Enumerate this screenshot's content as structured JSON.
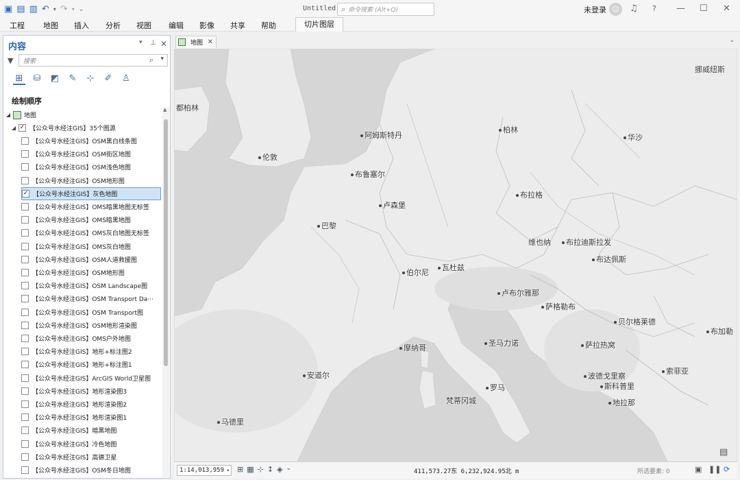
{
  "titlebar": {
    "title": "Untitled",
    "command_search_placeholder": "命令搜索 (Alt+Q)",
    "user": "未登录",
    "help": "?",
    "minimize": "—",
    "maximize": "☐",
    "close": "✕"
  },
  "menu": {
    "items": [
      "工程",
      "地图",
      "插入",
      "分析",
      "视图",
      "编辑",
      "影像",
      "共享",
      "帮助"
    ],
    "context_tab": "切片图层"
  },
  "contents": {
    "title": "内容",
    "search_placeholder": "搜索",
    "drawing_order": "绘制顺序",
    "map_node": "地图",
    "group_node": "【公众号水经注GIS】35个图源",
    "layers": [
      {
        "label": "【公众号水经注GIS】OSM黑白线条图",
        "checked": false
      },
      {
        "label": "【公众号水经注GIS】OSM街区地图",
        "checked": false
      },
      {
        "label": "【公众号水经注GIS】OSM浅色地图",
        "checked": false
      },
      {
        "label": "【公众号水经注GIS】OSM地形图",
        "checked": false
      },
      {
        "label": "【公众号水经注GIS】灰色地图",
        "checked": true
      },
      {
        "label": "【公众号水经注GIS】OMS暗黑地图无标签",
        "checked": false
      },
      {
        "label": "【公众号水经注GIS】OMS暗黑地图",
        "checked": false
      },
      {
        "label": "【公众号水经注GIS】OMS灰白地图无标签",
        "checked": false
      },
      {
        "label": "【公众号水经注GIS】OMS灰白地图",
        "checked": false
      },
      {
        "label": "【公众号水经注GIS】OSM人道救援图",
        "checked": false
      },
      {
        "label": "【公众号水经注GIS】OSM地形图",
        "checked": false
      },
      {
        "label": "【公众号水经注GIS】OSM Landscape图",
        "checked": false
      },
      {
        "label": "【公众号水经注GIS】OSM Transport Da···",
        "checked": false
      },
      {
        "label": "【公众号水经注GIS】OSM Transport图",
        "checked": false
      },
      {
        "label": "【公众号水经注GIS】OSM地形渲染图",
        "checked": false
      },
      {
        "label": "【公众号水经注GIS】OMS户外地图",
        "checked": false
      },
      {
        "label": "【公众号水经注GIS】地形+标注图2",
        "checked": false
      },
      {
        "label": "【公众号水经注GIS】地形+标注图1",
        "checked": false
      },
      {
        "label": "【公众号水经注GIS】ArcGIS World卫星图",
        "checked": false
      },
      {
        "label": "【公众号水经注GIS】地形渲染图3",
        "checked": false
      },
      {
        "label": "【公众号水经注GIS】地形渲染图2",
        "checked": false
      },
      {
        "label": "【公众号水经注GIS】地形渲染图1",
        "checked": false
      },
      {
        "label": "【公众号水经注GIS】暗黑地图",
        "checked": false
      },
      {
        "label": "【公众号水经注GIS】冷色地图",
        "checked": false
      },
      {
        "label": "【公众号水经注GIS】高德卫星",
        "checked": false
      },
      {
        "label": "【公众号水经注GIS】OSM冬日地图",
        "checked": false
      }
    ]
  },
  "map": {
    "tab_label": "地图",
    "cities": [
      {
        "name": "挪威纽斯"
      },
      {
        "name": "都柏林"
      },
      {
        "name": "阿姆斯特丹"
      },
      {
        "name": "柏林"
      },
      {
        "name": "华沙"
      },
      {
        "name": "伦敦"
      },
      {
        "name": "布鲁塞尔"
      },
      {
        "name": "卢森堡"
      },
      {
        "name": "布拉格"
      },
      {
        "name": "巴黎"
      },
      {
        "name": "维也纳"
      },
      {
        "name": "布拉迪斯拉发"
      },
      {
        "name": "布达佩斯"
      },
      {
        "name": "伯尔尼"
      },
      {
        "name": "瓦杜兹"
      },
      {
        "name": "卢布尔雅那"
      },
      {
        "name": "萨格勒布"
      },
      {
        "name": "贝尔格莱德"
      },
      {
        "name": "布加勒"
      },
      {
        "name": "圣马力诺"
      },
      {
        "name": "萨拉热窝"
      },
      {
        "name": "摩纳哥"
      },
      {
        "name": "安道尔"
      },
      {
        "name": "波德戈里察"
      },
      {
        "name": "斯科普里"
      },
      {
        "name": "索菲亚"
      },
      {
        "name": "罗马"
      },
      {
        "name": "梵蒂冈城"
      },
      {
        "name": "地拉那"
      },
      {
        "name": "马德里"
      }
    ]
  },
  "status": {
    "scale": "1:14,013,959",
    "coordinates": "411,573.27东 6,232,924.95北 m",
    "selected_features": "所选要素: 0"
  }
}
